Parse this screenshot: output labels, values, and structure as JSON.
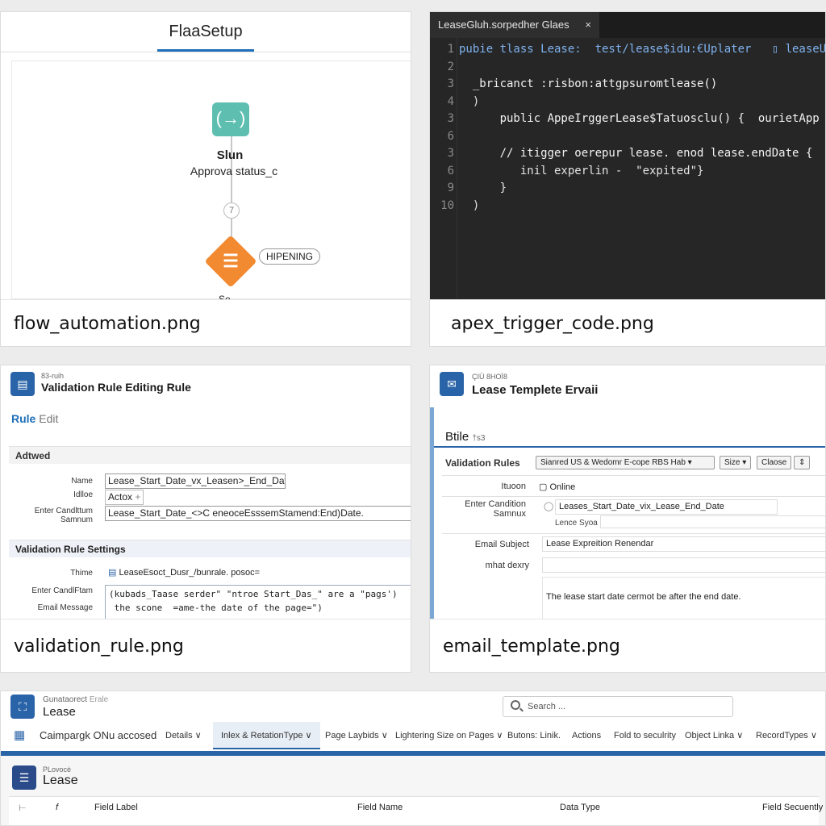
{
  "flow_card": {
    "header": "FlaaSetup",
    "node_title": "Slun",
    "node_subtitle": "Approva status_c",
    "connector_glyph": "7",
    "node_glyph": "(→)",
    "decision_glyph": "☰",
    "decision_pill": "HIPENING",
    "cut_label": "Se",
    "caption": "flow_automation.png"
  },
  "code_card": {
    "tab_title": "LeaseGluh.sorpedher Glaes",
    "tab_close": "×",
    "lines": [
      {
        "num": "1",
        "text": "pubie tlass Lease:  test/lease$idu:€Uplater   ▯ leaseUsta"
      },
      {
        "num": "2",
        "text": ""
      },
      {
        "num": "3",
        "text": "  _bricanct :risbon:attgpsuromtlease()"
      },
      {
        "num": "4",
        "text": "  )"
      },
      {
        "num": "3",
        "text": "      public AppeIrggerLease$Tatuosclu() {  ourietApp T"
      },
      {
        "num": "6",
        "text": ""
      },
      {
        "num": "3",
        "text": "      // itigger oerepur lease. enod lease.endDate {"
      },
      {
        "num": "6",
        "text": "         inil experlin -  \"expited\"}"
      },
      {
        "num": "9",
        "text": "      }"
      },
      {
        "num": "10",
        "text": "  )"
      }
    ],
    "caption": "apex_trigger_code.png"
  },
  "validation_card": {
    "breadcrumb": "83-ruih",
    "title": "Validation Rule Editing Rule",
    "rule_label": "Rule",
    "edit_label": "Edit",
    "section_adtwed": "Adtwed",
    "name_label": "Name",
    "name_value": "Lease_Start_Date_vx_Leasen>_End_Date",
    "idlloe_label": "Idlloe",
    "idlloe_value": "Actox",
    "idlloe_btn": "+",
    "enter_condition_label": "Enter Candlttum Samnum",
    "enter_condition_value": "Lease_Start_Date_<>C eneoceEsssemStamend:End)Date.",
    "section_settings": "Validation Rule Settings",
    "time_label": "Thime",
    "time_value": "LeaseEsoct_Dusr_/bunrale. posoc=",
    "enter_cond2_label": "Enter CandlFtam",
    "email_msg_label": "Email Message",
    "message_lines": [
      "(kubads_Taase serder\" \"ntroe Start_Das_\" are a \"pags')",
      " the scone  =ame-the date of the page=\")"
    ],
    "caption": "validation_rule.png"
  },
  "email_card": {
    "breadcrumb": "ÇIÙ 8HOÌ8",
    "title": "Lease Templete Ervaii",
    "btile_label": "Btile",
    "btile_small": "†s3",
    "validation_rules_label": "Validation Rules",
    "select_value": "Sianred US &  Wedomr E-cope RBS Hab",
    "size_btn": "Size",
    "close_btn": "Claose",
    "ltuoon_label": "Ituoon",
    "online_label": "Online",
    "enter_cond_label": "Enter Candition Samnux",
    "enter_cond_value": "Leases_Start_Date_vix_Lease_End_Date",
    "lence_label": "Lence Syoa",
    "email_subject_label": "Email Subject",
    "email_subject_value": "Lease Expreition Renendar",
    "mhat_label": "mhat dexry",
    "body_text": "The lease start date cermot be after the end date.",
    "caption": "email_template.png"
  },
  "object_manager": {
    "small_title": "Gunataorect",
    "small_title_tail": "Erale",
    "title": "Lease",
    "search_placeholder": "Search ...",
    "nav": [
      {
        "label": "Caimpargk ONu accosed"
      },
      {
        "label": "Details ∨"
      },
      {
        "label": "Inlex & RetationType ∨"
      },
      {
        "label": "Page Laybids ∨"
      },
      {
        "label": "Lightering Size on Pages ∨"
      },
      {
        "label": "Butons: Linik."
      },
      {
        "label": "Actions"
      },
      {
        "label": "Fold to seculrity"
      },
      {
        "label": "Object Linka ∨"
      },
      {
        "label": "RecordTypes ∨"
      }
    ],
    "lower_small": "PLovocè",
    "lower_title": "Lease",
    "columns": [
      "Field  Label",
      "Field Name",
      "Data Type",
      "Field Secuently"
    ],
    "col_icons": [
      "⊢",
      "f"
    ]
  }
}
